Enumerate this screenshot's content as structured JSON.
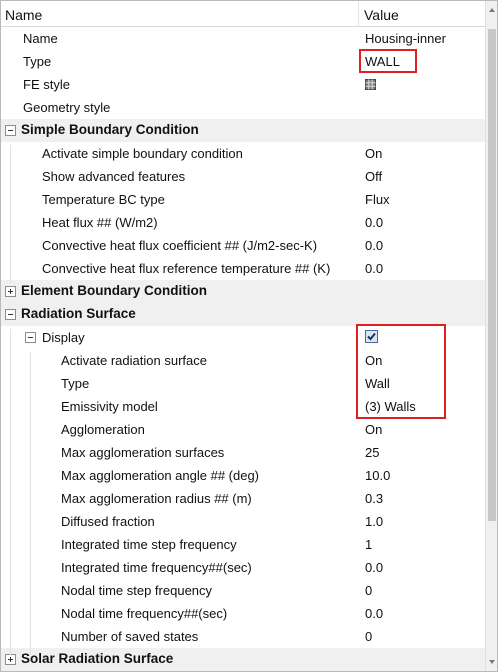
{
  "header": {
    "name_label": "Name",
    "value_label": "Value"
  },
  "general": {
    "name": {
      "label": "Name",
      "value": "Housing-inner"
    },
    "type": {
      "label": "Type",
      "value": "WALL"
    },
    "fe_style": {
      "label": "FE style",
      "icon": "fe-style-grid-icon"
    },
    "geometry_style": {
      "label": "Geometry style",
      "value": ""
    }
  },
  "simple_bc": {
    "title": "Simple Boundary Condition",
    "rows": [
      {
        "label": "Activate simple boundary condition",
        "value": "On"
      },
      {
        "label": "Show advanced features",
        "value": "Off"
      },
      {
        "label": "Temperature BC type",
        "value": "Flux"
      },
      {
        "label": "Heat flux ## (W/m2)",
        "value": "0.0"
      },
      {
        "label": "Convective heat flux coefficient ## (J/m2-sec-K)",
        "value": "0.0"
      },
      {
        "label": "Convective heat flux reference temperature ## (K)",
        "value": "0.0"
      }
    ]
  },
  "element_bc": {
    "title": "Element Boundary Condition"
  },
  "radiation": {
    "title": "Radiation Surface",
    "display": {
      "label": "Display",
      "checked": true
    },
    "rows": [
      {
        "label": "Activate radiation surface",
        "value": "On"
      },
      {
        "label": "Type",
        "value": "Wall"
      },
      {
        "label": "Emissivity model",
        "value": "(3) Walls"
      },
      {
        "label": "Agglomeration",
        "value": "On"
      },
      {
        "label": "Max agglomeration surfaces",
        "value": "25"
      },
      {
        "label": "Max agglomeration angle ## (deg)",
        "value": "10.0"
      },
      {
        "label": "Max agglomeration radius ## (m)",
        "value": "0.3"
      },
      {
        "label": "Diffused fraction",
        "value": "1.0"
      },
      {
        "label": "Integrated time step frequency",
        "value": "1"
      },
      {
        "label": "Integrated time frequency##(sec)",
        "value": "0.0"
      },
      {
        "label": "Nodal time step frequency",
        "value": "0"
      },
      {
        "label": "Nodal time frequency##(sec)",
        "value": "0.0"
      },
      {
        "label": "Number of saved states",
        "value": "0"
      }
    ]
  },
  "solar": {
    "title": "Solar Radiation Surface"
  },
  "colors": {
    "highlight": "#e02020",
    "section_bg": "#f0f0f0",
    "checkbox_fill": "#d7e6f7"
  }
}
